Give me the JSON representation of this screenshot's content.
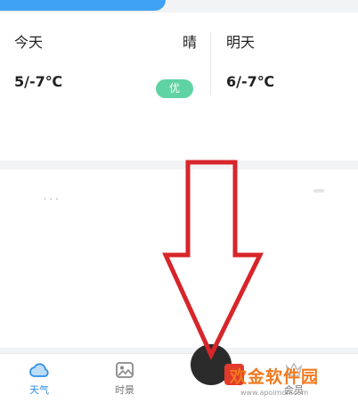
{
  "forecast": {
    "today": {
      "name": "今天",
      "condition": "晴",
      "temp": "5/-7℃",
      "aqi": "优"
    },
    "tomorrow": {
      "name": "明天",
      "temp": "6/-7℃"
    }
  },
  "detail": {
    "faded_title": "..."
  },
  "tabs": [
    {
      "label": "天气",
      "icon": "cloud-icon",
      "active": true
    },
    {
      "label": "时景",
      "icon": "image-icon",
      "active": false
    },
    {
      "label": "会员",
      "icon": "member-icon",
      "active": false
    }
  ],
  "watermark": {
    "text": "欢金软件园",
    "url": "www.apoimdn.com"
  },
  "colors": {
    "accent": "#3fa2f2",
    "aqi_good": "#5fd3a3",
    "arrow": "#d7252a",
    "watermark": "#f07a1f"
  }
}
